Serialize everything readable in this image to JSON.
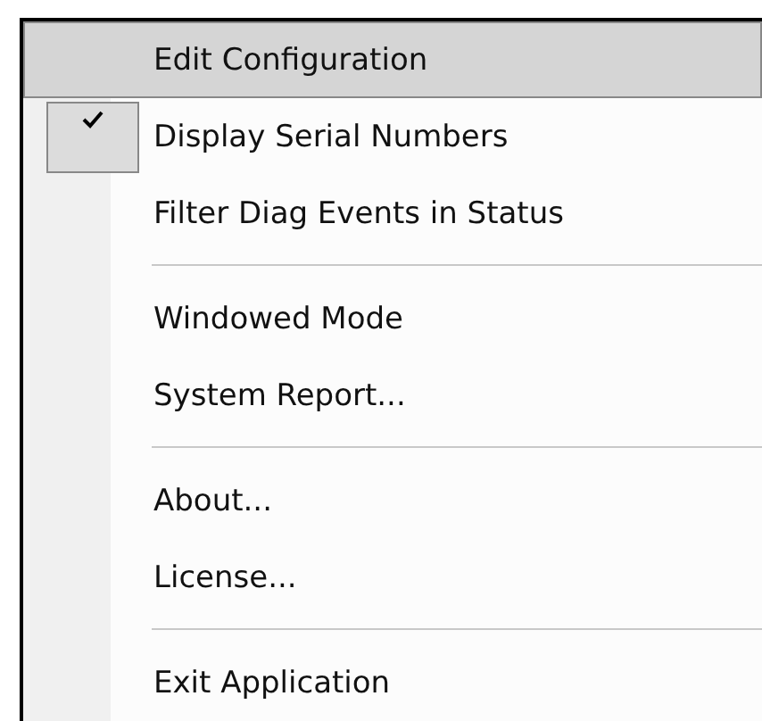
{
  "menu": {
    "items": [
      {
        "kind": "item",
        "label": "Edit Configuration",
        "selected": true,
        "checked": false
      },
      {
        "kind": "item",
        "label": "Display Serial Numbers",
        "selected": false,
        "checked": true
      },
      {
        "kind": "item",
        "label": "Filter Diag Events in Status",
        "selected": false,
        "checked": false
      },
      {
        "kind": "separator"
      },
      {
        "kind": "item",
        "label": "Windowed Mode",
        "selected": false,
        "checked": false
      },
      {
        "kind": "item",
        "label": "System Report...",
        "selected": false,
        "checked": false
      },
      {
        "kind": "separator"
      },
      {
        "kind": "item",
        "label": "About...",
        "selected": false,
        "checked": false
      },
      {
        "kind": "item",
        "label": "License...",
        "selected": false,
        "checked": false
      },
      {
        "kind": "separator"
      },
      {
        "kind": "item",
        "label": "Exit Application",
        "selected": false,
        "checked": false
      }
    ]
  }
}
